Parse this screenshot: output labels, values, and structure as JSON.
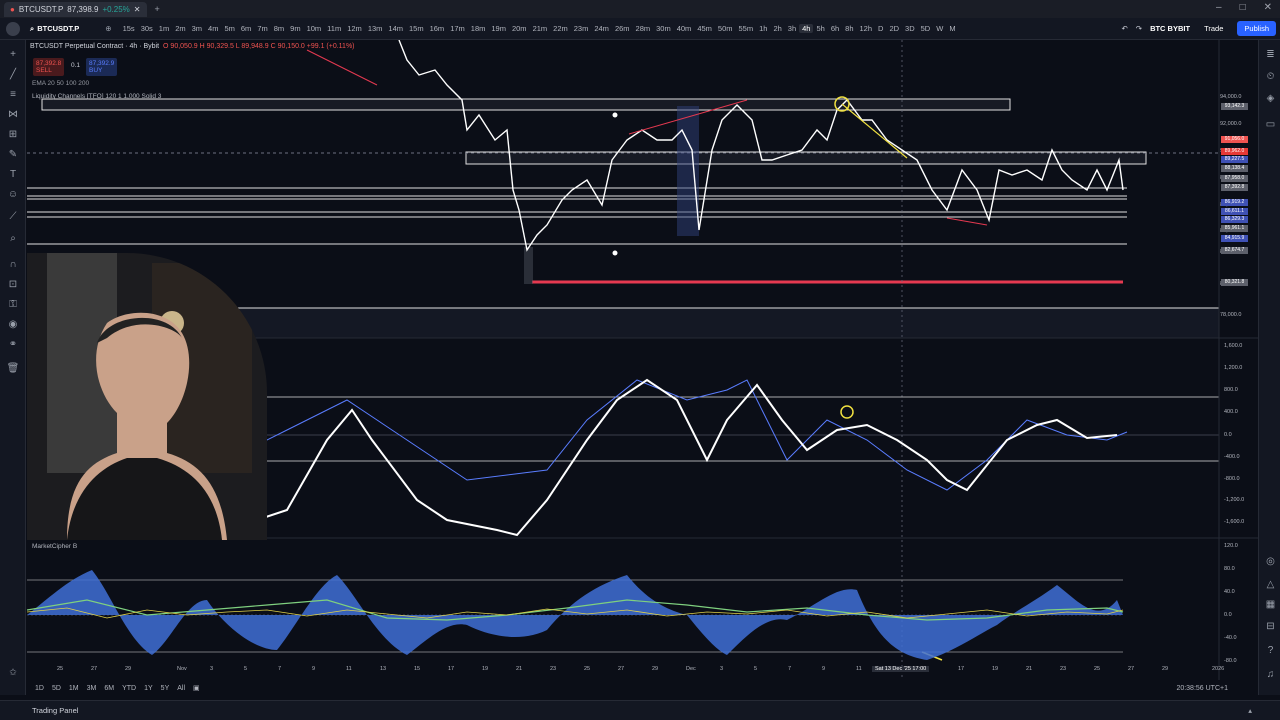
{
  "tab": {
    "symbol": "BTCUSDT.P",
    "price": "87,398.9",
    "change": "+0.25%"
  },
  "toolbar": {
    "symbol": "BTCUSDT.P",
    "timeframes": [
      "15s",
      "30s",
      "1m",
      "2m",
      "3m",
      "4m",
      "5m",
      "6m",
      "7m",
      "8m",
      "9m",
      "10m",
      "11m",
      "12m",
      "13m",
      "14m",
      "15m",
      "16m",
      "17m",
      "18m",
      "19m",
      "20m",
      "21m",
      "22m",
      "23m",
      "24m",
      "26m",
      "28m",
      "30m",
      "40m",
      "45m",
      "50m",
      "55m",
      "1h",
      "2h",
      "3h",
      "4h",
      "5h",
      "6h",
      "8h",
      "12h",
      "D",
      "2D",
      "3D",
      "5D",
      "W",
      "M"
    ],
    "active_tf": "4h",
    "broker_label": "BTC BYBIT",
    "trade": "Trade",
    "publish": "Publish"
  },
  "legend": {
    "title": "BTCUSDT Perpetual Contract · 4h · Bybit",
    "ohlc": "O 90,050.9 H 90,329.5 L 89,948.9 C 90,150.0 +99.1 (+0.11%)",
    "sell_price": "87,392.8",
    "sell": "SELL",
    "spread": "0.1",
    "buy_price": "87,392.9",
    "buy": "BUY",
    "ema": "EMA 20 50 100 200",
    "liq": "Liquidity Channels [TFO] 120 1 1,000 Solid 3"
  },
  "price_axis": [
    "94,000.0",
    "92,000.0",
    "90,000.0",
    "88,000.0",
    "86,000.0",
    "84,000.0",
    "82,000.0",
    "80,000.0",
    "78,000.0"
  ],
  "price_tags": [
    {
      "v": "93,142.3",
      "c": "#5d606b"
    },
    {
      "v": "91,056.0",
      "c": "#ef5350"
    },
    {
      "v": "89,962.0",
      "c": "#e53935"
    },
    {
      "v": "89,227.5",
      "c": "#3f51b5"
    },
    {
      "v": "88,138.4",
      "c": "#5d606b"
    },
    {
      "v": "87,958.0",
      "c": "#5d606b"
    },
    {
      "v": "87,392.8",
      "c": "#5d606b"
    },
    {
      "v": "86,919.2",
      "c": "#3f51b5"
    },
    {
      "v": "86,611.1",
      "c": "#3f51b5"
    },
    {
      "v": "86,329.3",
      "c": "#3f51b5"
    },
    {
      "v": "85,961.1",
      "c": "#5d606b"
    },
    {
      "v": "84,915.9",
      "c": "#3f51b5"
    },
    {
      "v": "82,674.7",
      "c": "#5d606b"
    },
    {
      "v": "80,321.8",
      "c": "#5d606b"
    }
  ],
  "osc_axis": [
    "1,600.0",
    "1,200.0",
    "800.0",
    "400.0",
    "0.0",
    "-400.0",
    "-800.0",
    "-1,200.0",
    "-1,600.0"
  ],
  "mcb": {
    "label": "MarketCipher B",
    "axis": [
      "120.0",
      "80.0",
      "40.0",
      "0.0",
      "-40.0",
      "-80.0"
    ]
  },
  "time_axis": [
    "25",
    "27",
    "29",
    "Nov",
    "3",
    "5",
    "7",
    "9",
    "11",
    "13",
    "15",
    "17",
    "19",
    "21",
    "23",
    "25",
    "27",
    "29",
    "Dec",
    "3",
    "5",
    "7",
    "9",
    "11",
    "Sat 13 Dec '25  17:00",
    "17",
    "19",
    "21",
    "23",
    "25",
    "27",
    "29",
    "2026"
  ],
  "bottom": {
    "ranges": [
      "1D",
      "5D",
      "1M",
      "3M",
      "6M",
      "YTD",
      "1Y",
      "5Y",
      "All"
    ],
    "clock": "20:38:56 UTC+1"
  },
  "footer": {
    "panel": "Trading Panel"
  },
  "colors": {
    "bg": "#0b0e17",
    "accent": "#2962ff",
    "up": "#26a69a",
    "down": "#ef5350",
    "candle": "#ffffff"
  }
}
